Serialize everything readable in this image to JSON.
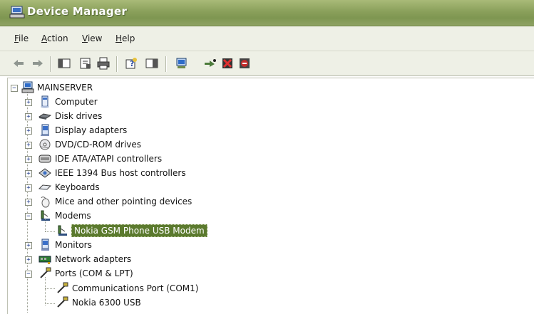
{
  "window": {
    "title": "Device Manager"
  },
  "menu": {
    "items": [
      "File",
      "Action",
      "View",
      "Help"
    ]
  },
  "toolbar": {
    "buttons": [
      "back-arrow-icon",
      "forward-arrow-icon",
      "show-hide-tree-icon",
      "properties-icon",
      "print-icon",
      "help-icon",
      "console-tree-icon",
      "scan-hardware-icon",
      "update-driver-icon",
      "disable-device-icon",
      "uninstall-device-icon"
    ]
  },
  "tree": {
    "root": "MAINSERVER",
    "categories": [
      {
        "label": "Computer",
        "icon": "computer-icon"
      },
      {
        "label": "Disk drives",
        "icon": "disk-drive-icon"
      },
      {
        "label": "Display adapters",
        "icon": "display-adapter-icon"
      },
      {
        "label": "DVD/CD-ROM drives",
        "icon": "dvd-drive-icon"
      },
      {
        "label": "IDE ATA/ATAPI controllers",
        "icon": "ide-controller-icon"
      },
      {
        "label": "IEEE 1394 Bus host controllers",
        "icon": "ieee1394-icon"
      },
      {
        "label": "Keyboards",
        "icon": "keyboard-icon"
      },
      {
        "label": "Mice and other pointing devices",
        "icon": "mouse-icon"
      },
      {
        "label": "Modems",
        "icon": "modem-icon",
        "expanded": true,
        "children": [
          "Nokia GSM Phone USB Modem"
        ]
      },
      {
        "label": "Monitors",
        "icon": "monitor-icon"
      },
      {
        "label": "Network adapters",
        "icon": "network-adapter-icon"
      },
      {
        "label": "Ports (COM & LPT)",
        "icon": "port-icon",
        "expanded": true,
        "children": [
          "Communications Port (COM1)",
          "Nokia 6300 USB"
        ]
      }
    ],
    "selected": "Nokia GSM Phone USB Modem"
  },
  "colors": {
    "titlebar": "#8aa05b",
    "selection": "#5b7a2e",
    "chrome": "#eef0e6"
  }
}
